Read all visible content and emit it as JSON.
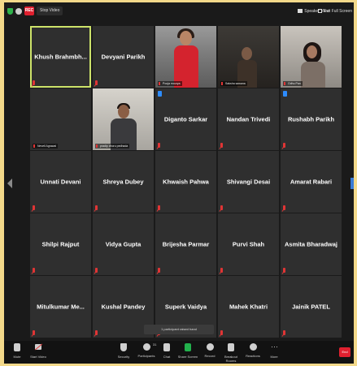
{
  "topbar": {
    "rec_label": "REC",
    "stop_label": "Stop Video",
    "speaker_view_label": "Speaker View",
    "exit_full_label": "Exit Full Screen"
  },
  "tiles": [
    {
      "name": "Khush Brahmbh...",
      "caption": "",
      "video": false,
      "active": true,
      "hand": false
    },
    {
      "name": "Devyani Parikh",
      "caption": "",
      "video": false,
      "active": false,
      "hand": false
    },
    {
      "name": "",
      "caption": "Pooja mourya",
      "video": "red",
      "active": false,
      "hand": false
    },
    {
      "name": "",
      "caption": "Saksha sawana",
      "video": "boy",
      "active": false,
      "hand": false
    },
    {
      "name": "",
      "caption": "Odhu Pan",
      "video": "girl",
      "active": false,
      "hand": false
    },
    {
      "name": "",
      "caption": "Nevell Agrawal",
      "video": false,
      "active": false,
      "hand": false
    },
    {
      "name": "",
      "caption": "pradip dhoru pedhada",
      "video": "man",
      "active": false,
      "hand": false
    },
    {
      "name": "Diganto Sarkar",
      "caption": "",
      "video": false,
      "active": false,
      "hand": true
    },
    {
      "name": "Nandan Trivedi",
      "caption": "",
      "video": false,
      "active": false,
      "hand": false
    },
    {
      "name": "Rushabh Parikh",
      "caption": "",
      "video": false,
      "active": false,
      "hand": true
    },
    {
      "name": "Unnati Devani",
      "caption": "",
      "video": false,
      "active": false,
      "hand": false
    },
    {
      "name": "Shreya Dubey",
      "caption": "",
      "video": false,
      "active": false,
      "hand": false
    },
    {
      "name": "Khwaish Pahwa",
      "caption": "",
      "video": false,
      "active": false,
      "hand": false
    },
    {
      "name": "Shivangi Desai",
      "caption": "",
      "video": false,
      "active": false,
      "hand": false
    },
    {
      "name": "Amarat Rabari",
      "caption": "",
      "video": false,
      "active": false,
      "hand": false
    },
    {
      "name": "Shilpi Rajput",
      "caption": "",
      "video": false,
      "active": false,
      "hand": false
    },
    {
      "name": "Vidya Gupta",
      "caption": "",
      "video": false,
      "active": false,
      "hand": false
    },
    {
      "name": "Brijesha Parmar",
      "caption": "",
      "video": false,
      "active": false,
      "hand": false
    },
    {
      "name": "Purvi Shah",
      "caption": "",
      "video": false,
      "active": false,
      "hand": false
    },
    {
      "name": "Asmita Bharadwaj",
      "caption": "",
      "video": false,
      "active": false,
      "hand": false
    },
    {
      "name": "Mitulkumar Me...",
      "caption": "",
      "video": false,
      "active": false,
      "hand": false
    },
    {
      "name": "Kushal Pandey",
      "caption": "",
      "video": false,
      "active": false,
      "hand": false
    },
    {
      "name": "Superk Vaidya",
      "caption": "",
      "video": false,
      "active": false,
      "hand": false
    },
    {
      "name": "Mahek Khatri",
      "caption": "",
      "video": false,
      "active": false,
      "hand": false
    },
    {
      "name": "Jainik PATEL",
      "caption": "",
      "video": false,
      "active": false,
      "hand": false
    }
  ],
  "toast": "1 participant raised hand",
  "toolbar": {
    "mute": "Mute",
    "start_video": "Start Video",
    "security": "Security",
    "participants": "Participants",
    "participants_count": "31",
    "chat": "Chat",
    "share_screen": "Share Screen",
    "record": "Record",
    "breakout_rooms": "Breakout Rooms",
    "reactions": "Reactions",
    "more": "More",
    "end": "End"
  },
  "colors": {
    "active_border": "#cde36a",
    "share_green": "#22b14c",
    "muted_red": "#e03535",
    "hand_blue": "#2d8cff"
  }
}
